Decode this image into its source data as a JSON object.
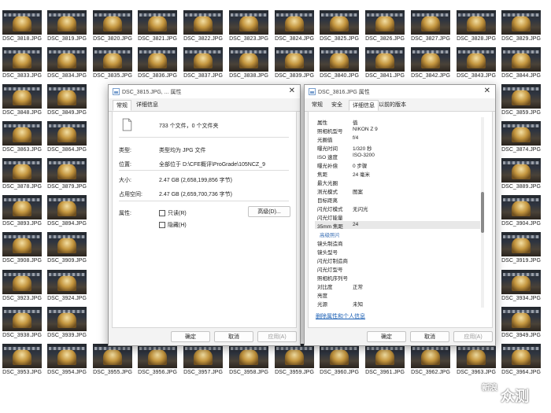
{
  "files": [
    [
      "DSC_3818.JPG",
      "DSC_3819.JPG",
      "DSC_3820.JPG",
      "DSC_3821.JPG",
      "DSC_3822.JPG",
      "DSC_3823.JPG",
      "DSC_3824.JPG",
      "DSC_3825.JPG",
      "DSC_3826.JPG",
      "DSC_3827.JPG",
      "DSC_3828.JPG",
      "DSC_3829.JPG"
    ],
    [
      "DSC_3833.JPG",
      "DSC_3834.JPG",
      "DSC_3835.JPG",
      "DSC_3836.JPG",
      "DSC_3837.JPG",
      "DSC_3838.JPG",
      "DSC_3839.JPG",
      "DSC_3840.JPG",
      "DSC_3841.JPG",
      "DSC_3842.JPG",
      "DSC_3843.JPG",
      "DSC_3844.JPG"
    ],
    [
      "DSC_3848.JPG",
      "DSC_3849.JPG",
      "",
      "",
      "",
      "",
      "",
      "",
      "",
      "",
      "",
      "DSC_3859.JPG"
    ],
    [
      "DSC_3863.JPG",
      "DSC_3864.JPG",
      "",
      "",
      "",
      "",
      "",
      "",
      "",
      "",
      "",
      "DSC_3874.JPG"
    ],
    [
      "DSC_3878.JPG",
      "DSC_3879.JPG",
      "",
      "",
      "",
      "",
      "",
      "",
      "",
      "",
      "",
      "DSC_3889.JPG"
    ],
    [
      "DSC_3893.JPG",
      "DSC_3894.JPG",
      "",
      "",
      "",
      "",
      "",
      "",
      "",
      "",
      "",
      "DSC_3904.JPG"
    ],
    [
      "DSC_3908.JPG",
      "DSC_3909.JPG",
      "",
      "",
      "",
      "",
      "",
      "",
      "",
      "",
      "",
      "DSC_3919.JPG"
    ],
    [
      "DSC_3923.JPG",
      "DSC_3924.JPG",
      "",
      "",
      "",
      "",
      "",
      "",
      "",
      "",
      "",
      "DSC_3934.JPG"
    ],
    [
      "DSC_3938.JPG",
      "DSC_3939.JPG",
      "",
      "",
      "",
      "",
      "",
      "",
      "",
      "",
      "",
      "DSC_3949.JPG"
    ],
    [
      "DSC_3953.JPG",
      "DSC_3954.JPG",
      "DSC_3955.JPG",
      "DSC_3956.JPG",
      "DSC_3957.JPG",
      "DSC_3958.JPG",
      "DSC_3959.JPG",
      "DSC_3960.JPG",
      "DSC_3961.JPG",
      "DSC_3962.JPG",
      "DSC_3963.JPG",
      "DSC_3964.JPG"
    ]
  ],
  "dialog1": {
    "title": "DSC_3815.JPG, ... 属性",
    "close": "✕",
    "tabs": [
      "常规",
      "详细信息"
    ],
    "summary": "733 个文件，0 个文件夹",
    "type_label": "类型:",
    "type_value": "类型均为 JPG 文件",
    "location_label": "位置:",
    "location_value": "全部位于 D:\\CFE概评\\ProGrade\\105NCZ_9",
    "size_label": "大小:",
    "size_value": "2.47 GB (2,658,199,856 字节)",
    "disk_label": "占用空间:",
    "disk_value": "2.47 GB (2,659,700,736 字节)",
    "attr_label": "属性:",
    "readonly": "只读(R)",
    "hidden": "隐藏(H)",
    "advanced": "高级(D)...",
    "ok": "确定",
    "cancel": "取消",
    "apply": "应用(A)"
  },
  "dialog2": {
    "title": "DSC_3816.JPG 属性",
    "close": "✕",
    "tabs": [
      "常规",
      "安全",
      "详细信息",
      "以前的版本"
    ],
    "rows": [
      {
        "k": "属性",
        "v": "值"
      },
      {
        "k": "照相机型号",
        "v": "NIKON Z 9"
      },
      {
        "k": "光圈值",
        "v": "f/4"
      },
      {
        "k": "曝光时间",
        "v": "1/320 秒"
      },
      {
        "k": "ISO 速度",
        "v": "ISO-3200"
      },
      {
        "k": "曝光补偿",
        "v": "0 步骤"
      },
      {
        "k": "焦距",
        "v": "24 毫米"
      },
      {
        "k": "最大光圈",
        "v": ""
      },
      {
        "k": "测光模式",
        "v": "图案"
      },
      {
        "k": "目标距离",
        "v": ""
      },
      {
        "k": "闪光灯模式",
        "v": "无闪光"
      },
      {
        "k": "闪光灯能量",
        "v": ""
      },
      {
        "k": "35mm 焦距",
        "v": "24"
      },
      {
        "k": "高级照片",
        "v": ""
      },
      {
        "k": "镜头制造商",
        "v": ""
      },
      {
        "k": "镜头型号",
        "v": ""
      },
      {
        "k": "闪光灯制造商",
        "v": ""
      },
      {
        "k": "闪光灯型号",
        "v": ""
      },
      {
        "k": "照相机序列号",
        "v": ""
      },
      {
        "k": "对比度",
        "v": "正常"
      },
      {
        "k": "亮度",
        "v": ""
      },
      {
        "k": "光源",
        "v": "未知"
      }
    ],
    "remove_link": "删除属性和个人信息",
    "ok": "确定",
    "cancel": "取消",
    "apply": "应用(A)"
  },
  "watermark": {
    "a": "新浪",
    "b": "众测"
  }
}
